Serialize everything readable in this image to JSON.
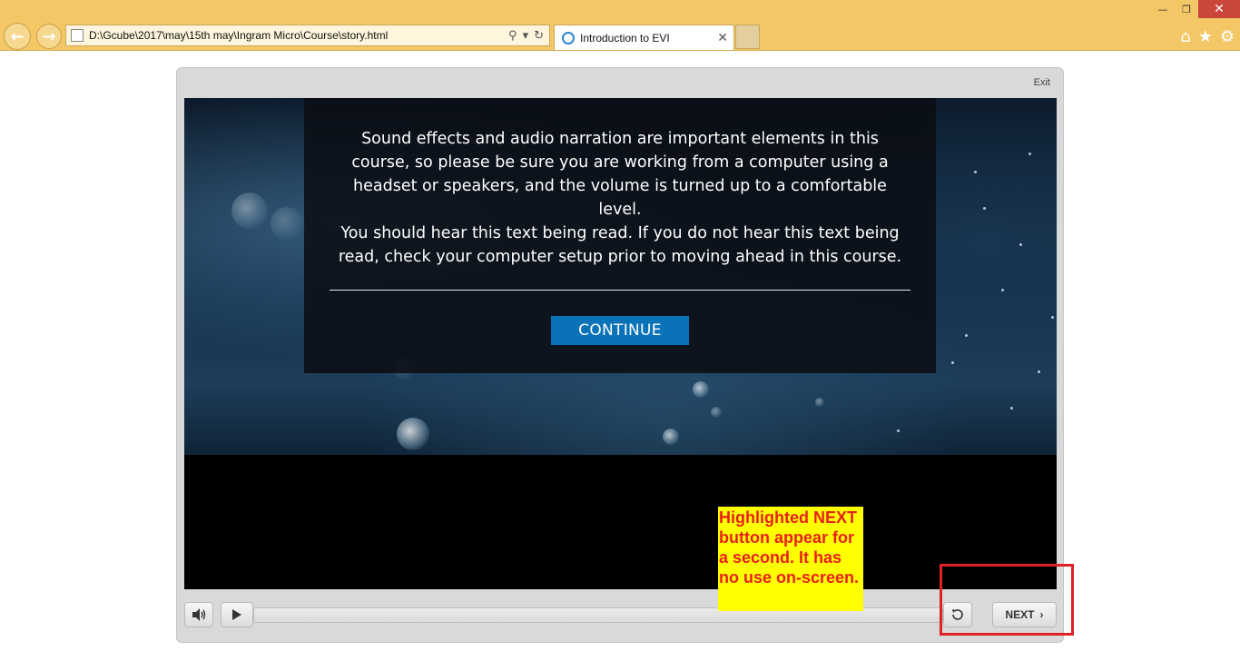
{
  "browser": {
    "address": "D:\\Gcube\\2017\\may\\15th may\\Ingram Micro\\Course\\story.html",
    "tab_title": "Introduction to EVI",
    "back_icon": "back-arrow-icon",
    "forward_icon": "forward-arrow-icon",
    "search_icon": "search-icon",
    "refresh_icon": "refresh-icon",
    "close_tab_icon": "close-icon",
    "home_icon": "home-icon",
    "favorites_icon": "star-icon",
    "settings_icon": "gear-icon"
  },
  "player": {
    "exit_label": "Exit",
    "paragraph_1": "Sound effects and audio narration are important elements in this course, so please be sure you are working from a computer using a headset or speakers, and the volume is turned up to a comfortable level.",
    "paragraph_2": "You should hear this text being read. If you do not hear this text being read, check your computer setup prior to moving ahead in this course.",
    "continue_label": "CONTINUE",
    "next_label": "NEXT",
    "progress": 0
  },
  "annotation": {
    "text": "Highlighted NEXT button appear for a second. It has no use on-screen.",
    "text_color": "#e8201b",
    "background": "#ffff00",
    "box_color": "#e01f26"
  }
}
